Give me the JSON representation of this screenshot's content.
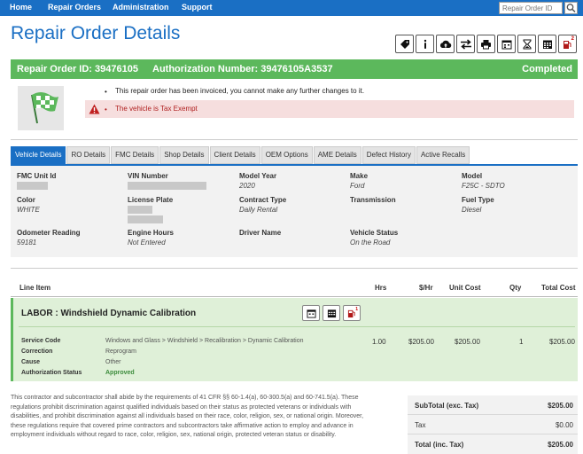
{
  "nav": {
    "items": [
      "Home",
      "Repair Orders",
      "Administration",
      "Support"
    ],
    "search_placeholder": "Repair Order ID"
  },
  "page": {
    "title": "Repair Order Details"
  },
  "toolbar": {
    "icons": [
      "tag-icon",
      "info-icon",
      "cloud-upload-icon",
      "transfer-icon",
      "print-icon",
      "calendar-icon",
      "hourglass-icon",
      "calendar-grid-icon",
      "fuel-icon"
    ],
    "fuel_badge": "2"
  },
  "status_bar": {
    "ro_label": "Repair Order ID: 39476105",
    "auth_label": "Authorization Number: 39476105A3537",
    "status": "Completed",
    "color": "#5cb85c"
  },
  "notices": {
    "invoiced": "This repair order has been invoiced, you cannot make any further changes to it.",
    "tax_exempt": "The vehicle is Tax Exempt"
  },
  "tabs": [
    "Vehicle Details",
    "RO Details",
    "FMC Details",
    "Shop Details",
    "Client Details",
    "OEM Options",
    "AME Details",
    "Defect History",
    "Active Recalls"
  ],
  "vehicle": {
    "fmc_unit_id": {
      "label": "FMC Unit Id",
      "value": ""
    },
    "vin": {
      "label": "VIN Number",
      "value": ""
    },
    "model_year": {
      "label": "Model Year",
      "value": "2020"
    },
    "make": {
      "label": "Make",
      "value": "Ford"
    },
    "model": {
      "label": "Model",
      "value": "F25C - SDTO"
    },
    "color": {
      "label": "Color",
      "value": "WHITE"
    },
    "license_plate": {
      "label": "License Plate",
      "value": ""
    },
    "contract_type": {
      "label": "Contract Type",
      "value": "Daily Rental"
    },
    "transmission": {
      "label": "Transmission",
      "value": ""
    },
    "fuel_type": {
      "label": "Fuel Type",
      "value": "Diesel"
    },
    "odometer": {
      "label": "Odometer Reading",
      "value": "59181"
    },
    "engine_hours": {
      "label": "Engine Hours",
      "value": "Not Entered"
    },
    "driver_name": {
      "label": "Driver Name",
      "value": ""
    },
    "vehicle_status": {
      "label": "Vehicle Status",
      "value": "On the Road"
    }
  },
  "line_items": {
    "headers": {
      "item": "Line Item",
      "hrs": "Hrs",
      "rate": "$/Hr",
      "unit_cost": "Unit Cost",
      "qty": "Qty",
      "total": "Total Cost"
    },
    "labor": {
      "title": "LABOR : Windshield Dynamic Calibration",
      "fuel_badge": "1",
      "service_code_label": "Service Code",
      "service_code": "Windows and Glass > Windshield > Recalibration > Dynamic Calibration",
      "correction_label": "Correction",
      "correction": "Reprogram",
      "cause_label": "Cause",
      "cause": "Other",
      "auth_status_label": "Authorization Status",
      "auth_status": "Approved",
      "hrs": "1.00",
      "rate": "$205.00",
      "unit_cost": "$205.00",
      "qty": "1",
      "total": "$205.00"
    }
  },
  "legal": "This contractor and subcontractor shall abide by the requirements of 41 CFR §§ 60-1.4(a), 60-300.5(a) and 60-741.5(a). These regulations prohibit discrimination against qualified individuals based on their status as protected veterans or individuals with disabilities, and prohibit discrimination against all individuals based on their race, color, religion, sex, or national origin. Moreover, these regulations require that covered prime contractors and subcontractors take affirmative action to employ and advance in employment individuals without regard to race, color, religion, sex, national origin, protected veteran status or disability.",
  "totals": {
    "subtotal_label": "SubTotal (exc. Tax)",
    "subtotal": "$205.00",
    "tax_label": "Tax",
    "tax": "$0.00",
    "total_label": "Total (inc. Tax)",
    "total": "$205.00"
  }
}
